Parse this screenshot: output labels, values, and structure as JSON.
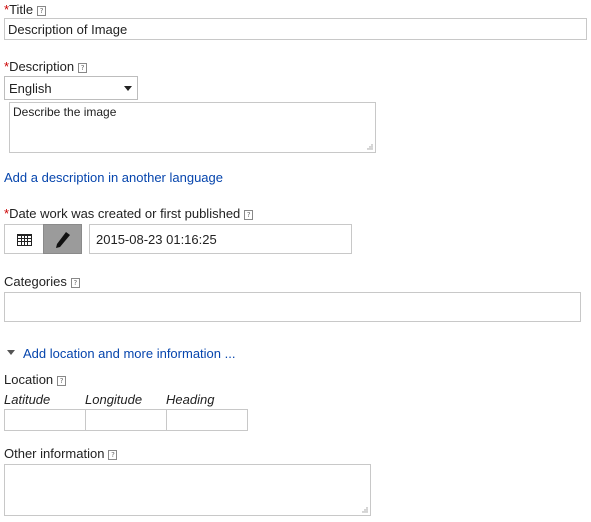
{
  "title_field": {
    "label": "Title",
    "value": "Description of Image"
  },
  "description_field": {
    "label": "Description",
    "language": "English",
    "placeholder": "Describe the image",
    "add_language_link": "Add a description in another language"
  },
  "date_field": {
    "label": "Date work was created or first published",
    "value": "2015-08-23 01:16:25"
  },
  "categories_field": {
    "label": "Categories"
  },
  "location_toggle": {
    "label": "Add location and more information ..."
  },
  "location": {
    "label": "Location",
    "latitude": "Latitude",
    "longitude": "Longitude",
    "heading": "Heading"
  },
  "other_information": {
    "label": "Other information"
  },
  "colors": {
    "required": "#cc0000",
    "link": "#0645ad",
    "border": "#c8c8c8",
    "active_button": "#9b9b9b"
  }
}
